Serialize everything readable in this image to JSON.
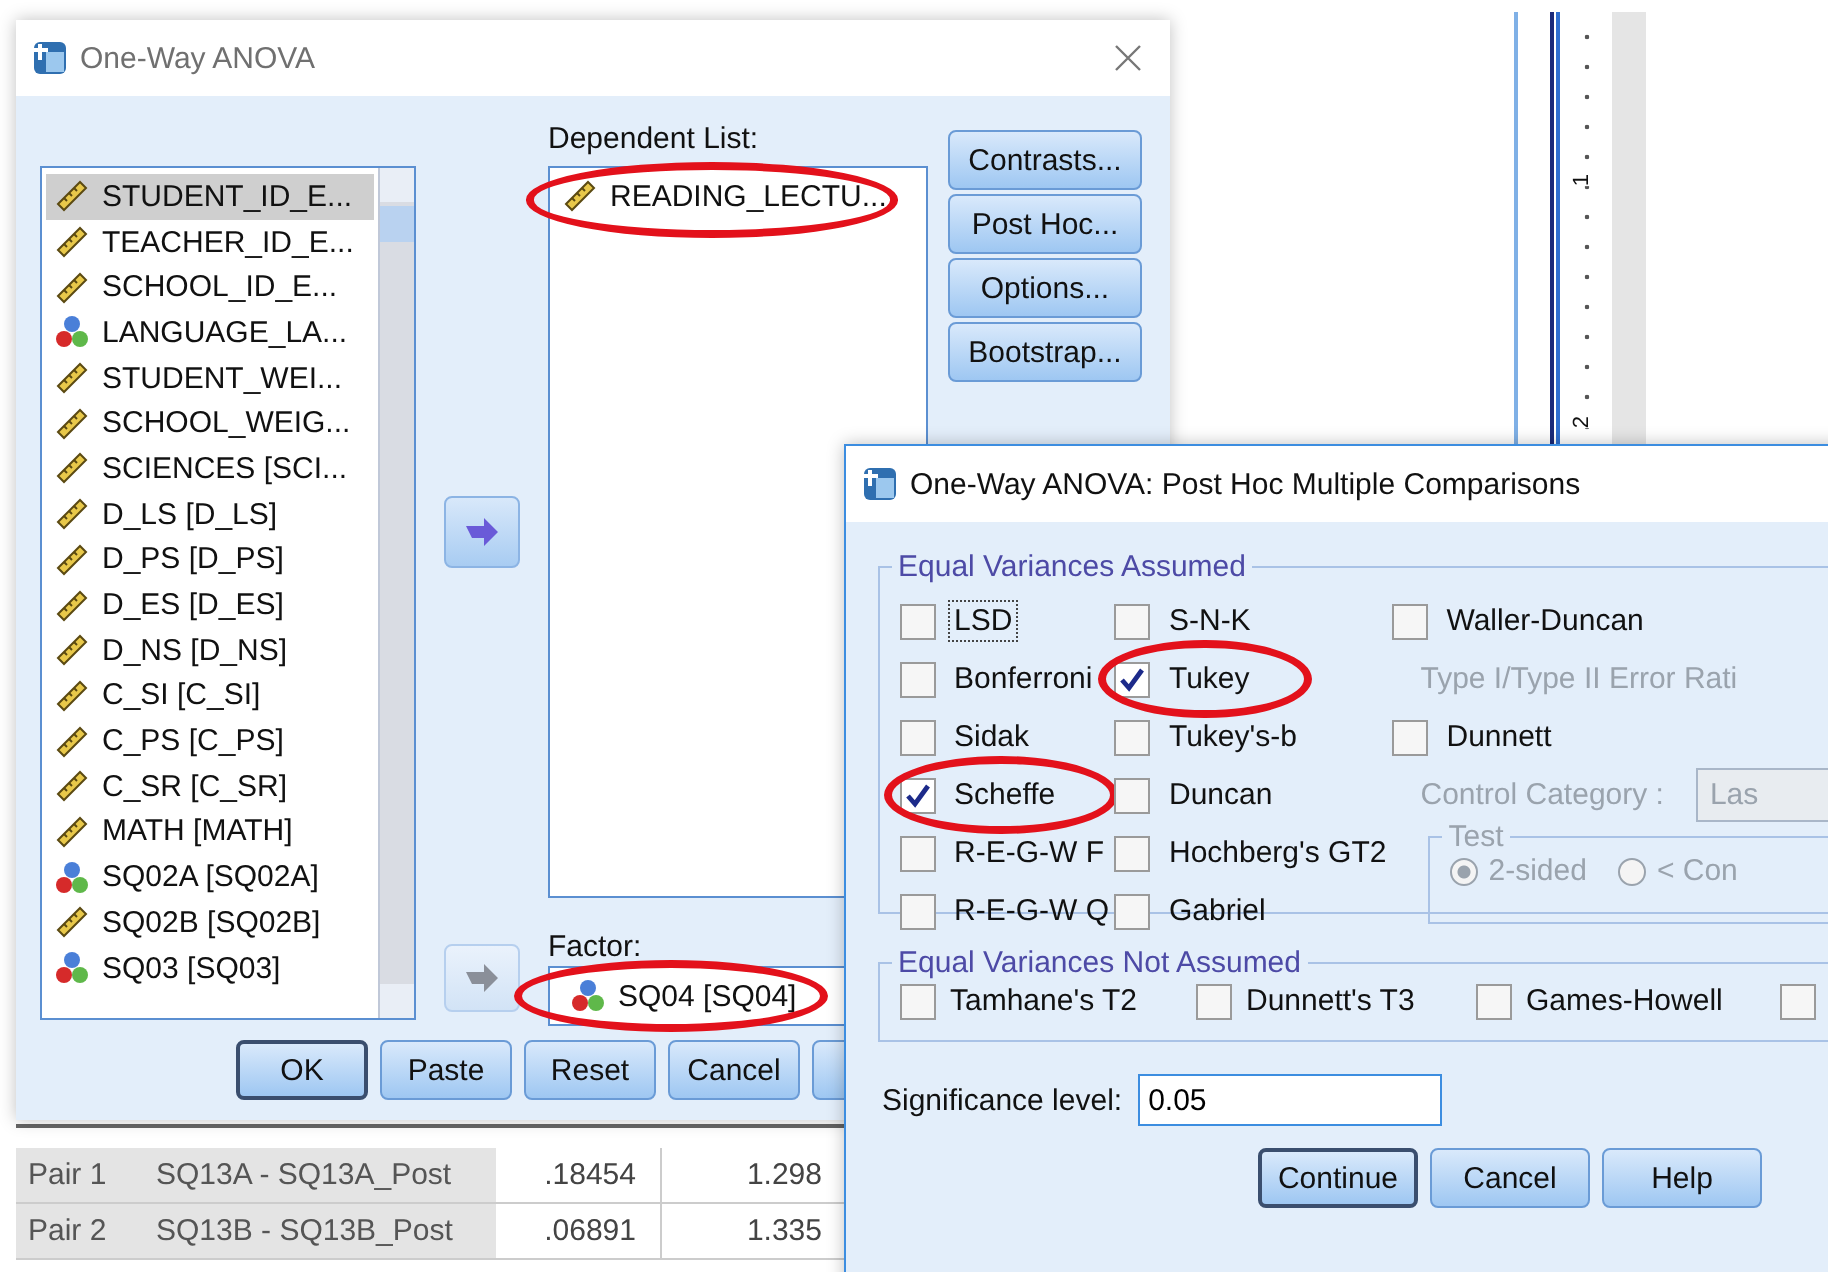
{
  "main_dialog": {
    "title": "One-Way ANOVA",
    "variables": [
      {
        "label": "STUDENT_ID_E...",
        "kind": "scale",
        "selected": true
      },
      {
        "label": "TEACHER_ID_E...",
        "kind": "scale",
        "selected": false
      },
      {
        "label": "SCHOOL_ID_E...",
        "kind": "scale",
        "selected": false
      },
      {
        "label": "LANGUAGE_LA...",
        "kind": "nominal",
        "selected": false
      },
      {
        "label": "STUDENT_WEI...",
        "kind": "scale",
        "selected": false
      },
      {
        "label": "SCHOOL_WEIG...",
        "kind": "scale",
        "selected": false
      },
      {
        "label": "SCIENCES [SCI...",
        "kind": "scale",
        "selected": false
      },
      {
        "label": "D_LS [D_LS]",
        "kind": "scale",
        "selected": false
      },
      {
        "label": "D_PS [D_PS]",
        "kind": "scale",
        "selected": false
      },
      {
        "label": "D_ES [D_ES]",
        "kind": "scale",
        "selected": false
      },
      {
        "label": "D_NS [D_NS]",
        "kind": "scale",
        "selected": false
      },
      {
        "label": "C_SI [C_SI]",
        "kind": "scale",
        "selected": false
      },
      {
        "label": "C_PS [C_PS]",
        "kind": "scale",
        "selected": false
      },
      {
        "label": "C_SR [C_SR]",
        "kind": "scale",
        "selected": false
      },
      {
        "label": "MATH [MATH]",
        "kind": "scale",
        "selected": false
      },
      {
        "label": "SQ02A [SQ02A]",
        "kind": "nominal",
        "selected": false
      },
      {
        "label": "SQ02B [SQ02B]",
        "kind": "scale",
        "selected": false
      },
      {
        "label": "SQ03 [SQ03]",
        "kind": "nominal",
        "selected": false
      }
    ],
    "move_buttons": [
      {
        "disabled": false
      },
      {
        "disabled": true
      }
    ],
    "dependent_list": {
      "label": "Dependent List:",
      "items": [
        {
          "label": "READING_LECTU...",
          "kind": "scale",
          "circled": true
        }
      ]
    },
    "factor": {
      "label": "Factor:",
      "value": {
        "label": "SQ04 [SQ04]",
        "kind": "nominal",
        "circled": true
      }
    },
    "side_buttons": [
      "Contrasts...",
      "Post Hoc...",
      "Options...",
      "Bootstrap..."
    ],
    "bottom_buttons": [
      {
        "label": "OK",
        "default": true
      },
      {
        "label": "Paste",
        "default": false
      },
      {
        "label": "Reset",
        "default": false
      },
      {
        "label": "Cancel",
        "default": false
      }
    ]
  },
  "background_table": {
    "rows": [
      {
        "column_1": "Pair 1",
        "column_2": "SQ13A - SQ13A_Post",
        "column_3": ".18454",
        "column_4": "1.298"
      },
      {
        "column_1": "Pair 2",
        "column_2": "SQ13B - SQ13B_Post",
        "column_3": ".06891",
        "column_4": "1.335"
      }
    ]
  },
  "ruler": {
    "labels": [
      "1",
      "2"
    ]
  },
  "post_hoc_dialog": {
    "title": "One-Way ANOVA: Post Hoc Multiple Comparisons",
    "assumed": {
      "title": "Equal Variances Assumed",
      "columns": [
        [
          {
            "kind": "checkbox",
            "label": "LSD",
            "checked": false,
            "focused": true,
            "circled": false
          },
          {
            "kind": "checkbox",
            "label": "Bonferroni",
            "checked": false,
            "focused": false,
            "circled": false
          },
          {
            "kind": "checkbox",
            "label": "Sidak",
            "checked": false,
            "focused": false,
            "circled": false
          },
          {
            "kind": "checkbox",
            "label": "Scheffe",
            "checked": true,
            "focused": false,
            "circled": true
          },
          {
            "kind": "checkbox",
            "label": "R-E-G-W F",
            "checked": false,
            "focused": false,
            "circled": false
          },
          {
            "kind": "checkbox",
            "label": "R-E-G-W Q",
            "checked": false,
            "focused": false,
            "circled": false
          }
        ],
        [
          {
            "kind": "checkbox",
            "label": "S-N-K",
            "checked": false,
            "focused": false,
            "circled": false
          },
          {
            "kind": "checkbox",
            "label": "Tukey",
            "checked": true,
            "focused": false,
            "circled": true
          },
          {
            "kind": "checkbox",
            "label": "Tukey's-b",
            "checked": false,
            "focused": false,
            "circled": false
          },
          {
            "kind": "checkbox",
            "label": "Duncan",
            "checked": false,
            "focused": false,
            "circled": false
          },
          {
            "kind": "checkbox",
            "label": "Hochberg's GT2",
            "checked": false,
            "focused": false,
            "circled": false
          },
          {
            "kind": "checkbox",
            "label": "Gabriel",
            "checked": false,
            "focused": false,
            "circled": false
          }
        ],
        [
          {
            "kind": "checkbox",
            "label": "Waller-Duncan",
            "checked": false,
            "focused": false,
            "circled": false
          },
          {
            "kind": "hint",
            "label": "Type I/Type II Error Rati"
          },
          {
            "kind": "checkbox",
            "label": "Dunnett",
            "checked": false,
            "focused": false,
            "circled": false
          },
          {
            "kind": "select",
            "label": "Control Category :",
            "value": "Las",
            "disabled": true
          }
        ]
      ],
      "test": {
        "title": "Test",
        "disabled": true,
        "options": [
          {
            "label": "2-sided",
            "selected": true
          },
          {
            "label": "< Con",
            "selected": false
          }
        ]
      }
    },
    "not_assumed": {
      "title": "Equal Variances Not Assumed",
      "items": [
        {
          "label": "Tamhane's T2",
          "checked": false
        },
        {
          "label": "Dunnett's T3",
          "checked": false
        },
        {
          "label": "Games-Howell",
          "checked": false
        },
        {
          "checked": false
        }
      ]
    },
    "significance": {
      "label": "Significance level:",
      "value": "0.05"
    },
    "buttons": [
      {
        "label": "Continue",
        "default": true
      },
      {
        "label": "Cancel",
        "default": false
      },
      {
        "label": "Help",
        "default": false
      }
    ]
  }
}
